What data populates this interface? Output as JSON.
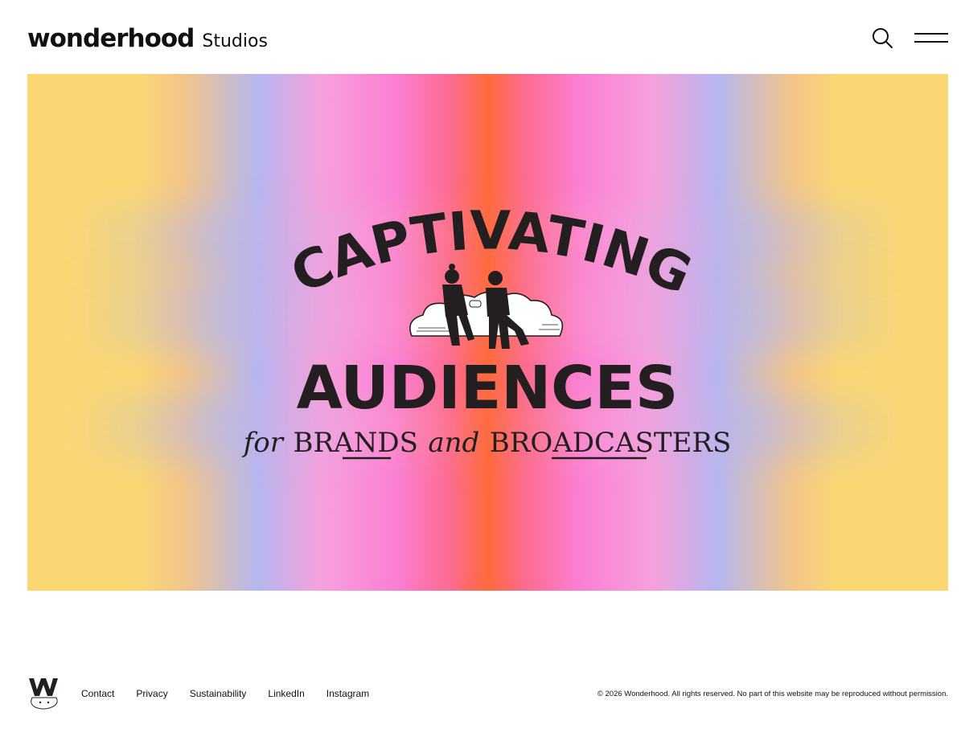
{
  "header": {
    "brand_main": "wonderhood",
    "brand_sub": "Studios",
    "search_icon": "search-icon",
    "menu_icon": "hamburger-menu-icon"
  },
  "hero": {
    "line1": "CAPTIVATING",
    "line2": "AUDIENCES",
    "tagline_for": "for",
    "tagline_brands": "BRANDS",
    "tagline_and": "and",
    "tagline_broadcasters": "BROADCASTERS",
    "illustration": "two-people-sitting-on-cloud",
    "colors": {
      "yellow": "#fbd774",
      "lavender": "#b5b7ef",
      "pink": "#fb7fd4",
      "orange": "#ff6a3a",
      "ink": "#231f20"
    }
  },
  "footer": {
    "logo_icon": "wonderhood-w-logo",
    "links": [
      "Contact",
      "Privacy",
      "Sustainability",
      "LinkedIn",
      "Instagram"
    ],
    "copyright": "© 2026 Wonderhood. All rights reserved. No part of this website may be reproduced without permission."
  }
}
